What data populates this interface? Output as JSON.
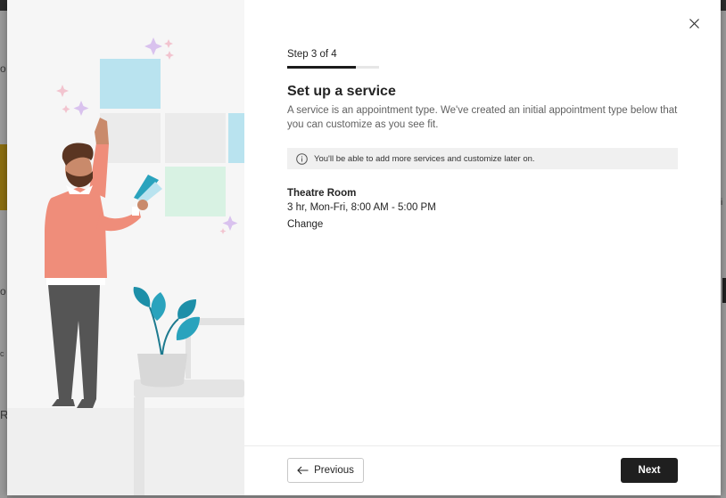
{
  "backdrop": {
    "letters": [
      "o",
      "o",
      "c",
      "R",
      "i"
    ]
  },
  "wizard": {
    "step_label": "Step 3 of 4",
    "progress_fraction": 0.75,
    "title": "Set up a service",
    "description": "A service is an appointment type. We've created an initial appointment type below that you can customize as you see fit.",
    "info_text": "You'll be able to add more services and customize later on.",
    "service": {
      "name": "Theatre Room",
      "detail": "3 hr, Mon-Fri, 8:00 AM - 5:00 PM",
      "change_label": "Change"
    },
    "previous_label": "Previous",
    "next_label": "Next"
  },
  "colors": {
    "tile_blue": "#b9e3ef",
    "tile_green": "#d8f2e3",
    "tile_gray": "#ebebeb",
    "sparkle": "#d9c2ee",
    "shirt": "#ef8d7a",
    "pants": "#555555",
    "plant_leaf": "#1d8fa8",
    "next_button_bg": "#1f1f1f"
  }
}
